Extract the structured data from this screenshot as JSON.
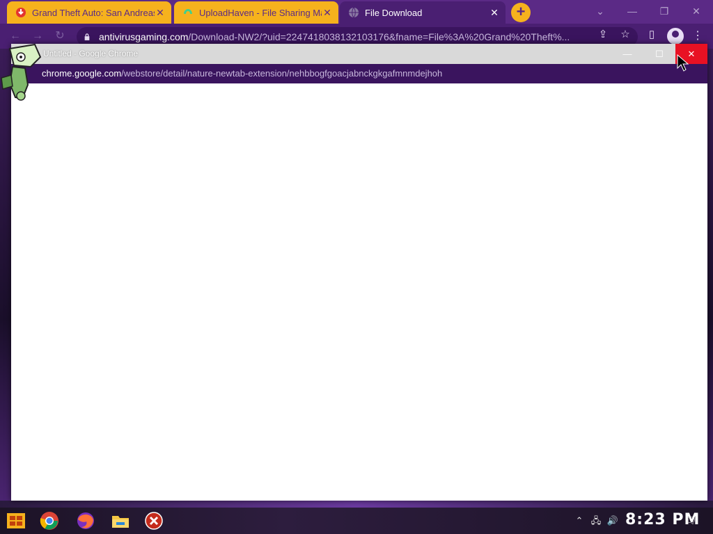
{
  "outer_browser": {
    "tabs": [
      {
        "title": "Grand Theft Auto: San Andreas",
        "state": "inactive",
        "icon": "red-download-icon"
      },
      {
        "title": "UploadHaven - File Sharing Made Simple",
        "state": "inactive",
        "icon": "uploadhaven-icon"
      },
      {
        "title": "File Download",
        "state": "active",
        "icon": "globe-icon"
      }
    ],
    "close_glyph": "✕",
    "new_tab_glyph": "+",
    "window_controls": {
      "dropdown": "⌄",
      "minimize": "—",
      "restore": "❐",
      "close": "✕"
    },
    "address": {
      "host": "antivirusgaming.com",
      "path": "/Download-NW2/?uid=2247418038132103176&fname=File%3A%20Grand%20Theft%..."
    },
    "nav": {
      "back": "←",
      "forward": "→",
      "reload": "↻"
    },
    "omnibox_icons": {
      "share": "⇪",
      "star": "☆",
      "side_panel": "▯",
      "menu": "⋮"
    }
  },
  "popup": {
    "title": "Untitled - Google Chrome",
    "controls": {
      "minimize": "—",
      "maximize": "☐",
      "close": "✕"
    },
    "url_host": "chrome.google.com",
    "url_rest": "/webstore/detail/nature-newtab-extension/nehbbogfgoacjabnckgkgafmnmdejhoh"
  },
  "taskbar": {
    "apps": [
      "start-menu-icon",
      "chrome-icon",
      "firefox-icon",
      "file-explorer-icon",
      "error-icon"
    ],
    "tray": {
      "chevron": "⌃",
      "network": "🖧",
      "volume": "🔊",
      "notifications": "🗨"
    },
    "clock": "8:23 PM"
  },
  "colors": {
    "accent_purple": "#5b2a86",
    "tab_yellow": "#f6b21d",
    "close_red": "#e81123"
  }
}
